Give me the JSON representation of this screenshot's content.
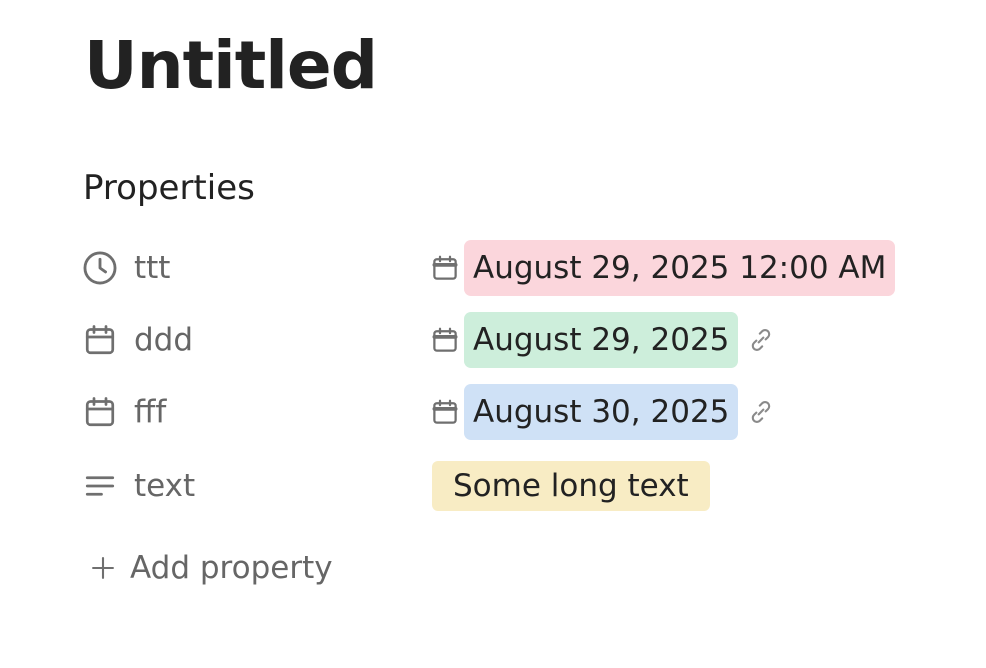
{
  "page": {
    "title": "Untitled"
  },
  "properties_section": {
    "heading": "Properties",
    "rows": [
      {
        "name": "ttt",
        "icon": "clock-icon",
        "value": "August 29, 2025 12:00 AM",
        "chip_color": "#fbd6dc",
        "has_link": false
      },
      {
        "name": "ddd",
        "icon": "calendar-icon",
        "value": "August 29, 2025",
        "chip_color": "#cdeedb",
        "has_link": true
      },
      {
        "name": "fff",
        "icon": "calendar-icon",
        "value": "August 30, 2025",
        "chip_color": "#cfe1f6",
        "has_link": true
      },
      {
        "name": "text",
        "icon": "text-lines-icon",
        "value": "Some long text",
        "chip_color": "#f8ecc4",
        "has_link": false
      }
    ],
    "add_label": "Add property"
  },
  "colors": {
    "title_text": "#222222",
    "muted_text": "#666666",
    "icon_gray": "#6f6f6f"
  }
}
